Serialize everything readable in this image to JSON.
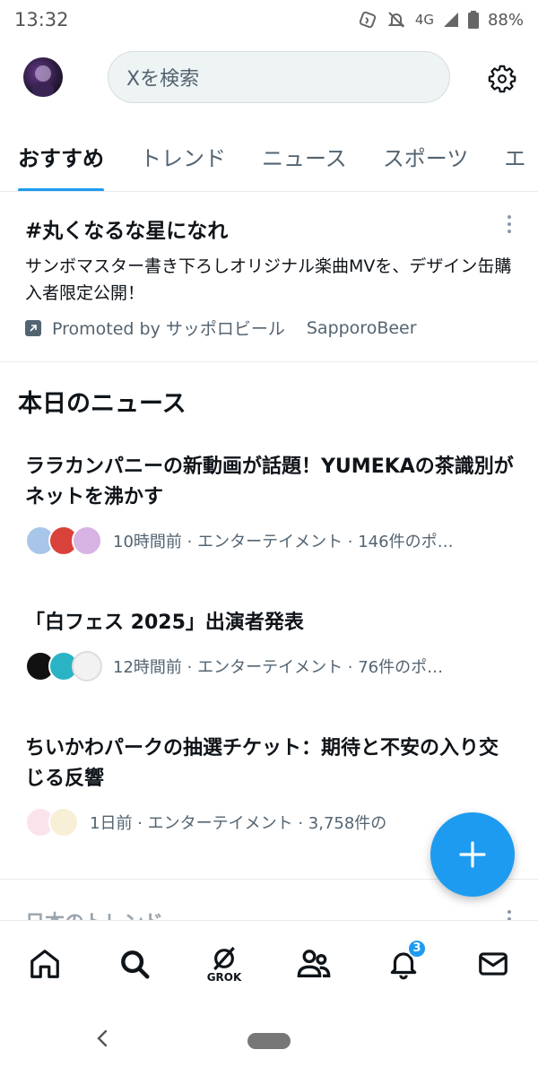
{
  "status_bar": {
    "time": "13:32",
    "network": "4G",
    "battery": "88%"
  },
  "header": {
    "search_placeholder": "Xを検索"
  },
  "tabs": [
    {
      "label": "おすすめ",
      "active": true
    },
    {
      "label": "トレンド",
      "active": false
    },
    {
      "label": "ニュース",
      "active": false
    },
    {
      "label": "スポーツ",
      "active": false
    },
    {
      "label": "エ",
      "active": false
    }
  ],
  "promoted": {
    "title": "#丸くなるな星になれ",
    "description": "サンボマスター書き下ろしオリジナル楽曲MVを、デザイン缶購入者限定公開！",
    "promoted_by": "Promoted by サッポロビール",
    "handle": "SapporoBeer"
  },
  "news_section": {
    "title": "本日のニュース",
    "items": [
      {
        "headline": "ララカンパニーの新動画が話題！YUMEKAの茶識別がネットを沸かす",
        "meta": "10時間前 · エンターテイメント · 146件のポ…"
      },
      {
        "headline": "「白フェス 2025」出演者発表",
        "meta": "12時間前 · エンターテイメント · 76件のポ…"
      },
      {
        "headline": "ちいかわパークの抽選チケット：期待と不安の入り交じる反響",
        "meta": "1日前 · エンターテイメント · 3,758件の"
      }
    ]
  },
  "trend_peek": {
    "title": "日本のトレンド"
  },
  "fab": {
    "icon": "plus-icon"
  },
  "bottom_nav": {
    "grok_label": "GROK",
    "notification_count": "3"
  },
  "colors": {
    "accent": "#1d9bf0",
    "text": "#0f1419",
    "secondary": "#536471"
  }
}
